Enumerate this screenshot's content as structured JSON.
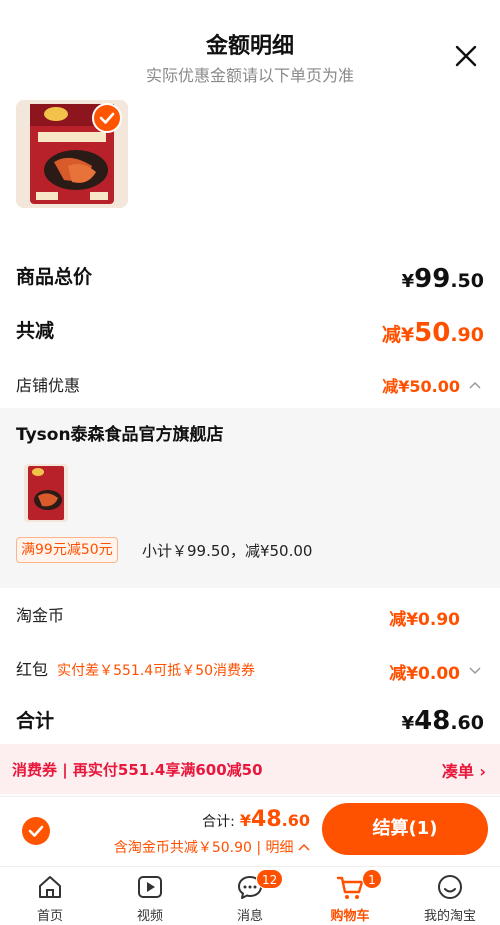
{
  "header": {
    "title": "金额明细",
    "subtitle": "实际优惠金额请以下单页为准"
  },
  "summary": {
    "goods_total_label": "商品总价",
    "goods_total_symbol": "¥",
    "goods_total_int": "99",
    "goods_total_dec": ".50",
    "discount_label": "共减",
    "discount_prefix": "减¥",
    "discount_int": "50",
    "discount_dec": ".90",
    "store_discount_label": "店铺优惠",
    "store_discount_value": "减¥50.00"
  },
  "shop": {
    "name": "Tyson泰森食品官方旗舰店",
    "promo_tag": "满99元减50元",
    "subtotal": "小计￥99.50，减¥50.00"
  },
  "coins": {
    "label": "淘金币",
    "value": "减¥0.90"
  },
  "redpacket": {
    "label": "红包",
    "note": "实付差￥551.4可抵￥50消费券",
    "value": "减¥0.00"
  },
  "total": {
    "label": "合计",
    "symbol": "¥",
    "int": "48",
    "dec": ".60"
  },
  "coupon_bar": {
    "text": "消费券 | 再实付551.4享满600减50",
    "action": "凑单 ›"
  },
  "checkout": {
    "total_label": "合计:",
    "total_symbol": "¥",
    "total_int": "48",
    "total_dec": ".60",
    "savings": "含淘金币共减￥50.90 | 明细",
    "pay_button": "结算(1)"
  },
  "tabbar": {
    "items": [
      {
        "label": "首页",
        "icon": "home-icon"
      },
      {
        "label": "视频",
        "icon": "video-icon"
      },
      {
        "label": "消息",
        "icon": "message-icon",
        "badge": "12"
      },
      {
        "label": "购物车",
        "icon": "cart-icon",
        "badge": "1",
        "active": true
      },
      {
        "label": "我的淘宝",
        "icon": "profile-icon"
      }
    ]
  },
  "colors": {
    "accent": "#ff5000",
    "coupon": "#e8173c"
  }
}
